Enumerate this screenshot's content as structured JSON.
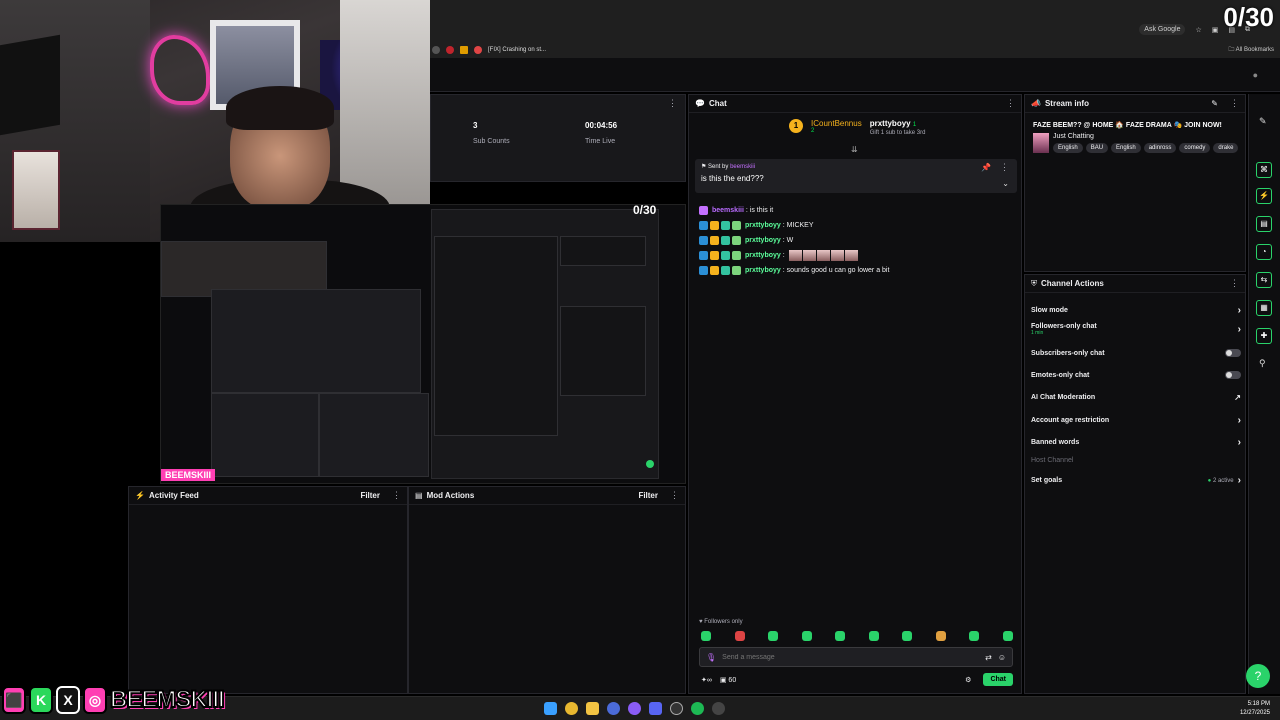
{
  "overlay": {
    "counter": "0/30",
    "social_name": "BEEMSKIII",
    "social_icons": [
      "twitch-icon",
      "kick-icon",
      "x-icon",
      "instagram-icon"
    ]
  },
  "browser": {
    "tab_label": "[FIX] Crashing on st...",
    "ask_google": "Ask Google",
    "bookmarks": "All Bookmarks"
  },
  "stats": {
    "sub_counts_value": "3",
    "sub_counts_label": "Sub Counts",
    "time_live_value": "00:04:56",
    "time_live_label": "Time Live"
  },
  "preview": {
    "counter": "0/30",
    "brand": "BEEMSKIII"
  },
  "chat": {
    "title": "Chat",
    "gift": {
      "rank": "1",
      "gifter": "ICountBennus",
      "gifter_count": "2",
      "recipient": "prxttyboyy",
      "recipient_count": "1",
      "note": "Gift 1 sub to take 3rd"
    },
    "pinned": {
      "sent_by_label": "Sent by",
      "sent_by_user": "beemskiii",
      "message": "is this the end???"
    },
    "messages": [
      {
        "user": "beemskiii",
        "text": ": is this it",
        "color": "purple"
      },
      {
        "user": "prxttyboyy",
        "text": ": MICKEY",
        "color": "green"
      },
      {
        "user": "prxttyboyy",
        "text": ": W",
        "color": "green"
      },
      {
        "user": "prxttyboyy",
        "text": ":",
        "color": "green",
        "emotes": 5
      },
      {
        "user": "prxttyboyy",
        "text": ": sounds good u can go lower a bit",
        "color": "green"
      }
    ],
    "followers_only": "Followers only",
    "input_placeholder": "Send a message",
    "points": "60",
    "chat_button": "Chat"
  },
  "stream_info": {
    "title": "Stream info",
    "stream_title": "FAZE BEEM?? @ HOME 🏠 FAZE DRAMA 🎭 JOIN NOW!",
    "category": "Just Chatting",
    "tags": [
      "English",
      "BAU",
      "English",
      "adinross",
      "comedy",
      "drake"
    ]
  },
  "channel_actions": {
    "title": "Channel Actions",
    "rows": [
      {
        "label": "Slow mode",
        "kind": "chevron"
      },
      {
        "label": "Followers-only chat",
        "sub": "1 min",
        "kind": "chevron"
      },
      {
        "label": "Subscribers-only chat",
        "kind": "toggle"
      },
      {
        "label": "Emotes-only chat",
        "kind": "toggle"
      },
      {
        "label": "AI Chat Moderation",
        "kind": "external"
      },
      {
        "label": "Account age restriction",
        "kind": "chevron"
      },
      {
        "label": "Banned words",
        "kind": "chevron"
      },
      {
        "label": "Host Channel",
        "kind": "disabled"
      },
      {
        "label": "Set goals",
        "kind": "chevron",
        "status": "2 active"
      }
    ]
  },
  "activity_feed": {
    "title": "Activity Feed",
    "filter": "Filter"
  },
  "mod_actions": {
    "title": "Mod Actions",
    "filter": "Filter"
  },
  "taskbar": {
    "time": "5:18 PM",
    "date": "12/27/2025"
  },
  "colors": {
    "accent": "#2ad36a",
    "brand_pink": "#ff3fb3",
    "gold": "#f5b21d"
  }
}
